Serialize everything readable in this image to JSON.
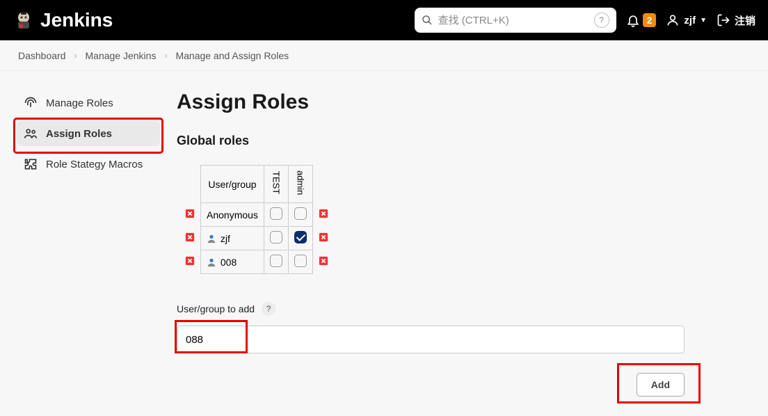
{
  "header": {
    "brand": "Jenkins",
    "search_placeholder": "查找 (CTRL+K)",
    "notification_count": "2",
    "username": "zjf",
    "logout_label": "注销"
  },
  "breadcrumb": {
    "items": [
      "Dashboard",
      "Manage Jenkins",
      "Manage and Assign Roles"
    ]
  },
  "sidebar": {
    "items": [
      {
        "label": "Manage Roles"
      },
      {
        "label": "Assign Roles"
      },
      {
        "label": "Role Stategy Macros"
      }
    ],
    "active_index": 1
  },
  "page": {
    "title": "Assign Roles",
    "section_title": "Global roles",
    "table": {
      "user_header": "User/group",
      "role_columns": [
        "TEST",
        "admin"
      ],
      "rows": [
        {
          "name": "Anonymous",
          "has_user_icon": false,
          "checks": [
            false,
            false
          ]
        },
        {
          "name": "zjf",
          "has_user_icon": true,
          "checks": [
            false,
            true
          ]
        },
        {
          "name": "008",
          "has_user_icon": true,
          "checks": [
            false,
            false
          ]
        }
      ]
    },
    "add_field_label": "User/group to add",
    "add_field_value": "088",
    "add_button_label": "Add"
  }
}
